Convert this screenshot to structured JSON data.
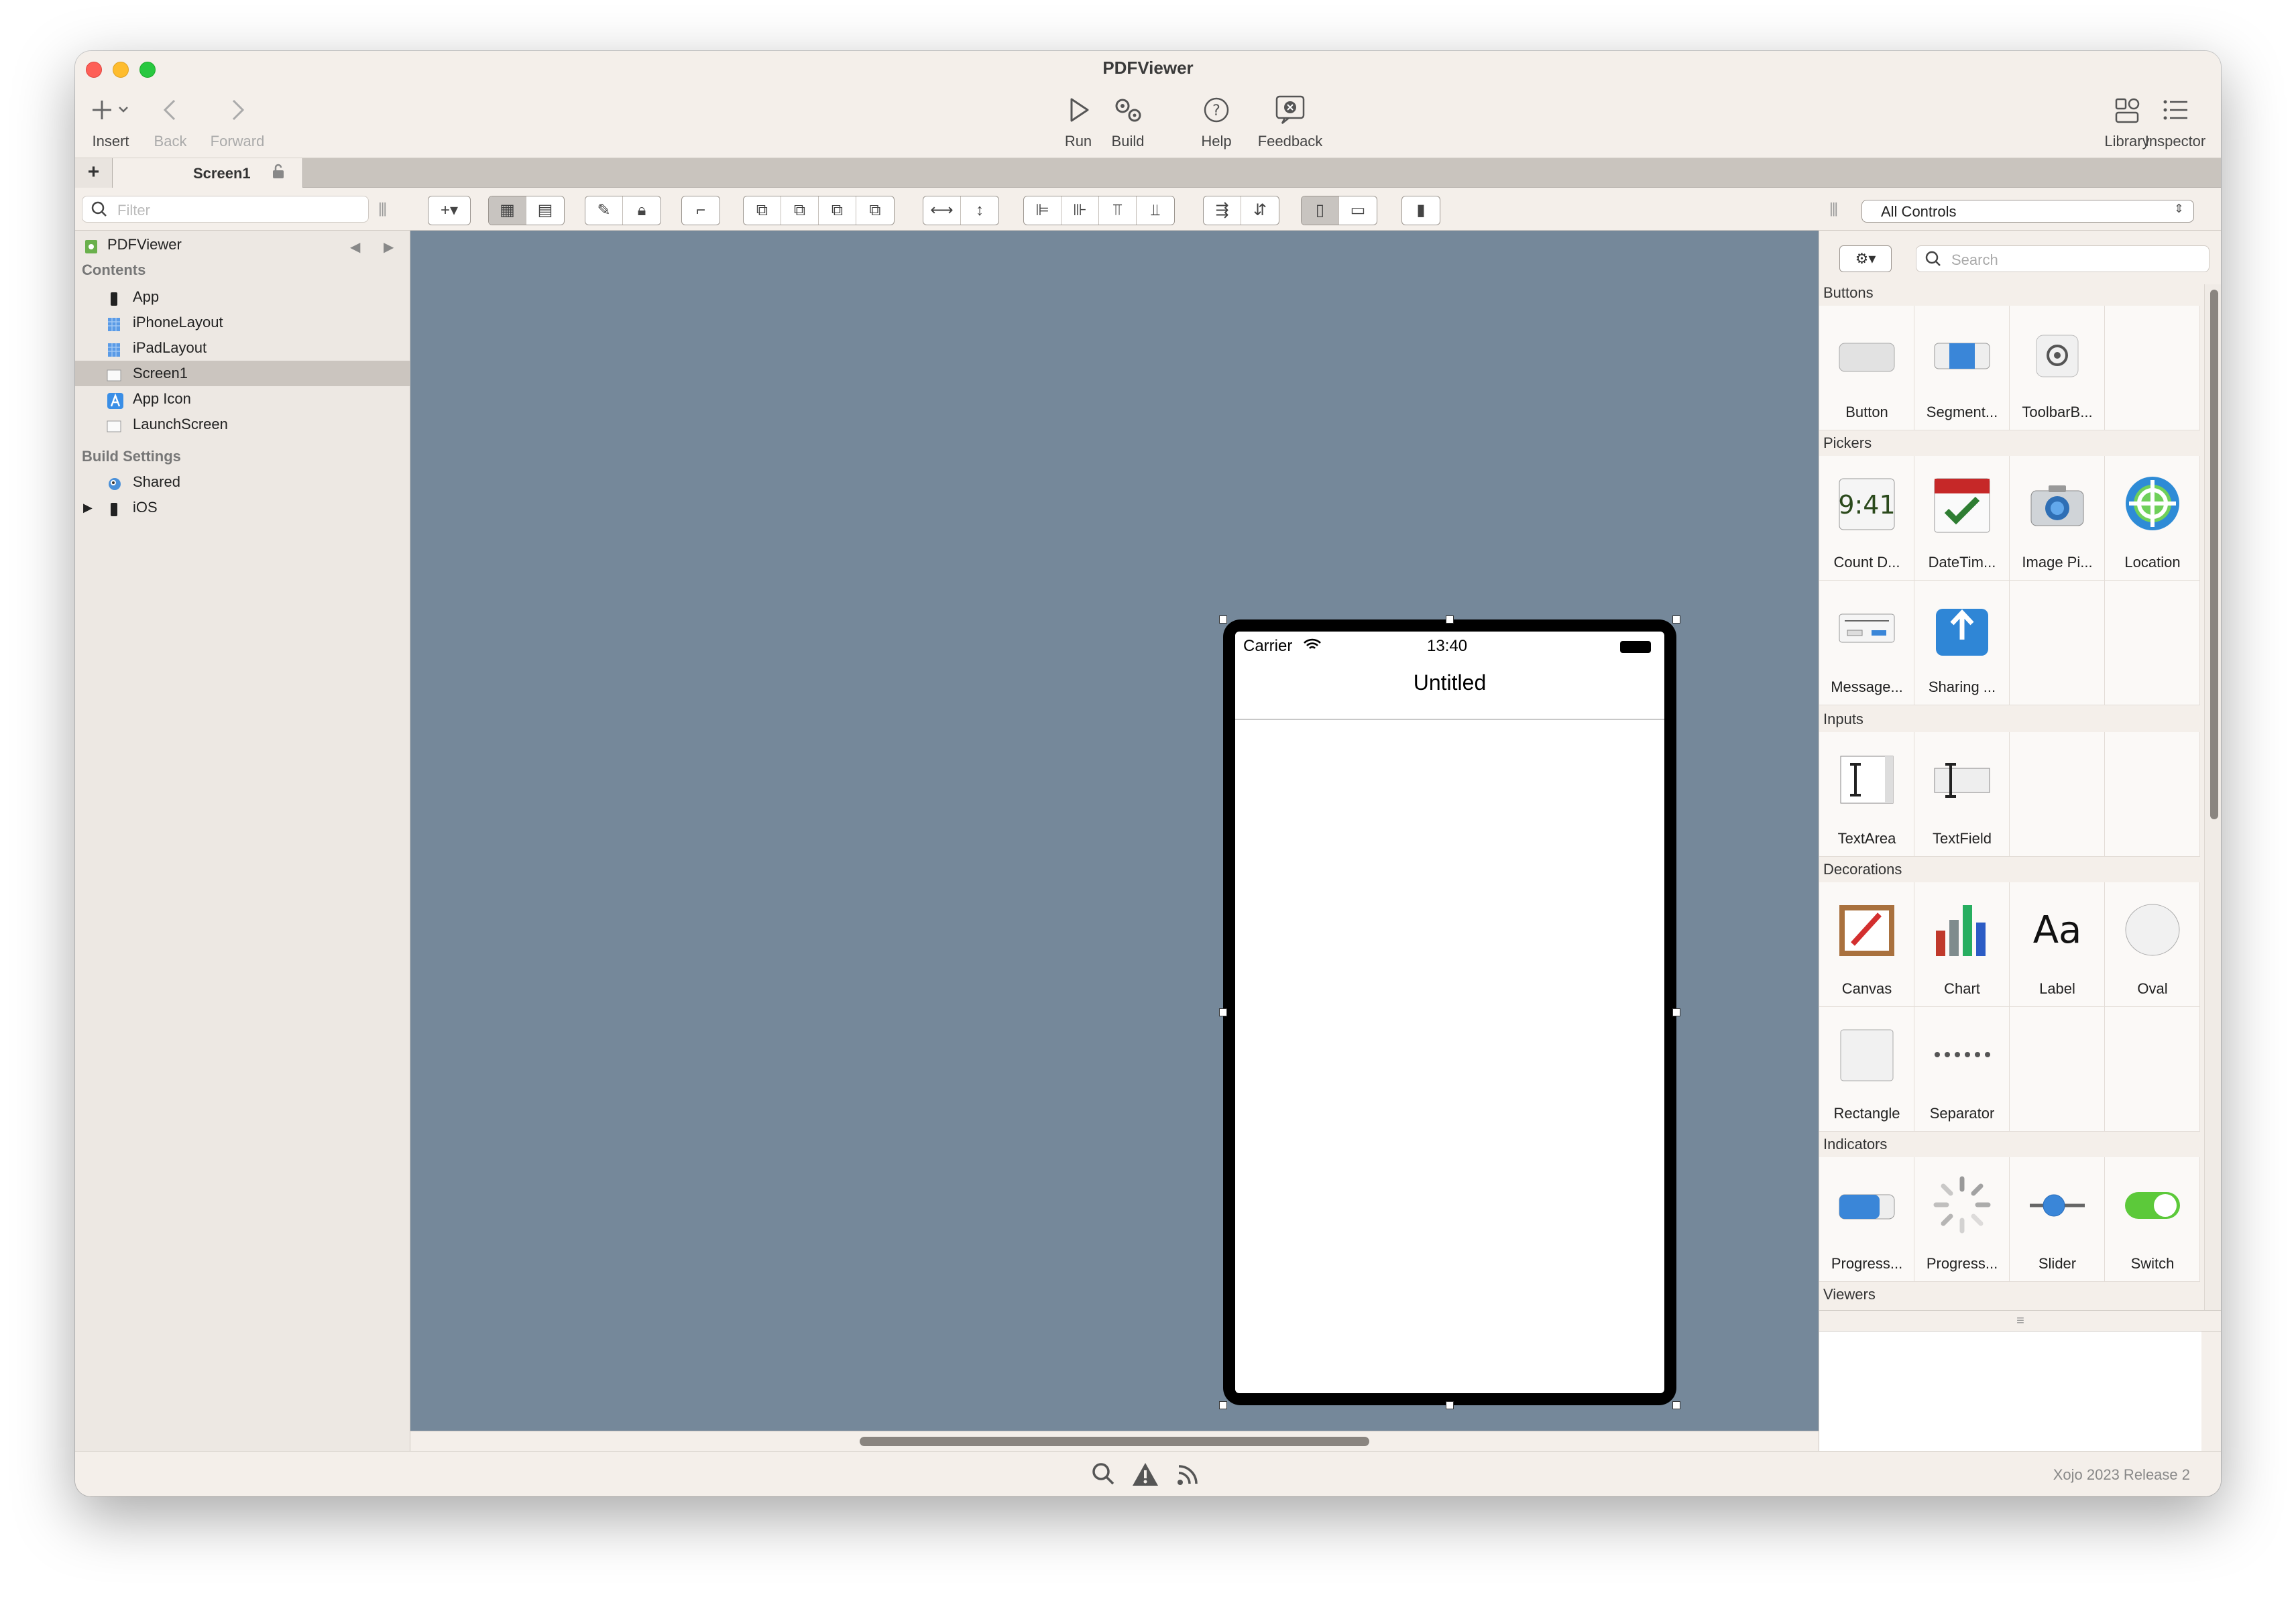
{
  "window": {
    "title": "PDFViewer"
  },
  "toolbar": {
    "insert": "Insert",
    "back": "Back",
    "forward": "Forward",
    "run": "Run",
    "build": "Build",
    "help": "Help",
    "feedback": "Feedback",
    "library": "Library",
    "inspector": "Inspector"
  },
  "tabs": {
    "add": "+",
    "active": "Screen1"
  },
  "navigator": {
    "filter_placeholder": "Filter",
    "project": "PDFViewer",
    "contents_header": "Contents",
    "items": [
      {
        "label": "App",
        "icon": "app-icon"
      },
      {
        "label": "iPhoneLayout",
        "icon": "layout-icon"
      },
      {
        "label": "iPadLayout",
        "icon": "layout-icon"
      },
      {
        "label": "Screen1",
        "icon": "screen-icon",
        "selected": true
      },
      {
        "label": "App Icon",
        "icon": "appicon-icon"
      },
      {
        "label": "LaunchScreen",
        "icon": "screen-icon"
      }
    ],
    "build_header": "Build Settings",
    "build_items": [
      {
        "label": "Shared",
        "icon": "shared-icon"
      },
      {
        "label": "iOS",
        "icon": "ios-icon"
      }
    ]
  },
  "device": {
    "carrier": "Carrier",
    "time": "13:40",
    "nav_title": "Untitled"
  },
  "library": {
    "selector": "All Controls",
    "search_placeholder": "Search",
    "categories": {
      "buttons": "Buttons",
      "pickers": "Pickers",
      "inputs": "Inputs",
      "decorations": "Decorations",
      "indicators": "Indicators",
      "viewers": "Viewers"
    },
    "controls": {
      "button": "Button",
      "segment": "Segment...",
      "toolbar": "ToolbarB...",
      "countdown": "Count D...",
      "datetime": "DateTim...",
      "imagepicker": "Image Pi...",
      "location": "Location",
      "message": "Message...",
      "sharing": "Sharing ...",
      "textarea": "TextArea",
      "textfield": "TextField",
      "canvas": "Canvas",
      "chart": "Chart",
      "label": "Label",
      "oval": "Oval",
      "rectangle": "Rectangle",
      "separator": "Separator",
      "progressbar": "Progress...",
      "progresswheel": "Progress...",
      "slider": "Slider",
      "switch": "Switch"
    },
    "icon_text": {
      "countdown": "9:41",
      "label": "Aa"
    }
  },
  "statusbar": {
    "version": "Xojo 2023 Release 2"
  }
}
